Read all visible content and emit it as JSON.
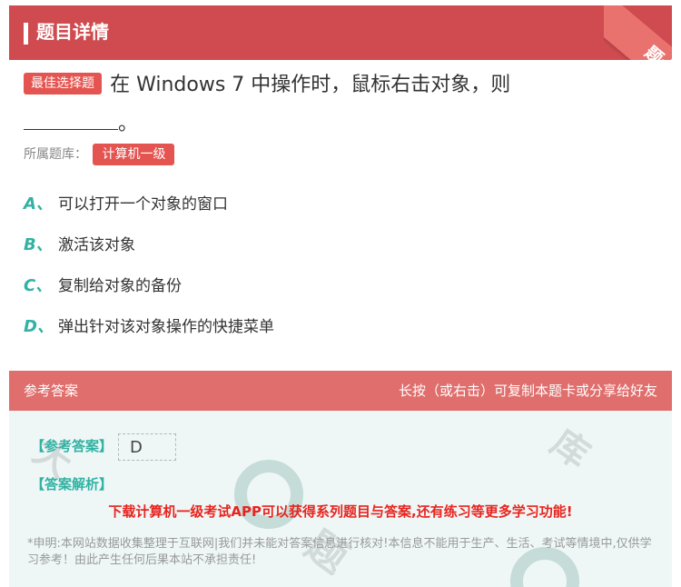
{
  "header": {
    "title": "题目详情",
    "ribbon_label": "题卡"
  },
  "question": {
    "type_badge": "最佳选择题",
    "text": "在 Windows 7 中操作时，鼠标右击对象，则",
    "tail": "。"
  },
  "bank": {
    "label": "所属题库：",
    "value": "计算机一级"
  },
  "options": [
    {
      "letter": "A、",
      "text": "可以打开一个对象的窗口"
    },
    {
      "letter": "B、",
      "text": "激活该对象"
    },
    {
      "letter": "C、",
      "text": "复制给对象的备份"
    },
    {
      "letter": "D、",
      "text": "弹出针对该对象操作的快捷菜单"
    }
  ],
  "answer_bar": {
    "left": "参考答案",
    "right": "长按（或右击）可复制本题卡或分享给好友"
  },
  "answer": {
    "ref_label": "【参考答案】",
    "ref_value": "D",
    "analysis_label": "【答案解析】",
    "promo": "下载计算机一级考试APP可以获得系列题目与答案,还有练习等更多学习功能!",
    "disclaimer": "*申明:本网站数据收集整理于互联网|我们并未能对答案信息进行核对!本信息不能用于生产、生活、考试等情境中,仅供学习参考！由此产生任何后果本站不承担责任!"
  },
  "colors": {
    "header": "#cf4b4f",
    "badge": "#e45450",
    "letter": "#31b2a3",
    "promo": "#e8241f"
  }
}
